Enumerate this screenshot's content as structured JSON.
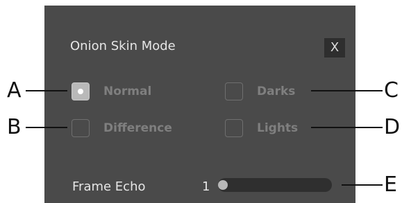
{
  "dialog": {
    "title": "Onion Skin Mode",
    "close_label": "X"
  },
  "options": [
    {
      "label": "Normal",
      "checked": true
    },
    {
      "label": "Darks",
      "checked": false
    },
    {
      "label": "Difference",
      "checked": false
    },
    {
      "label": "Lights",
      "checked": false
    }
  ],
  "frame_echo": {
    "label": "Frame Echo",
    "value": "1"
  },
  "callouts": {
    "a": "A",
    "b": "B",
    "c": "C",
    "d": "D",
    "e": "E"
  },
  "colors": {
    "panel": "#4a4a4a",
    "text": "#e6e6e6",
    "option_text": "#7f7f7f",
    "checked_fill": "#b9b9b9",
    "track": "#2f2f2f",
    "callout": "#111111"
  }
}
